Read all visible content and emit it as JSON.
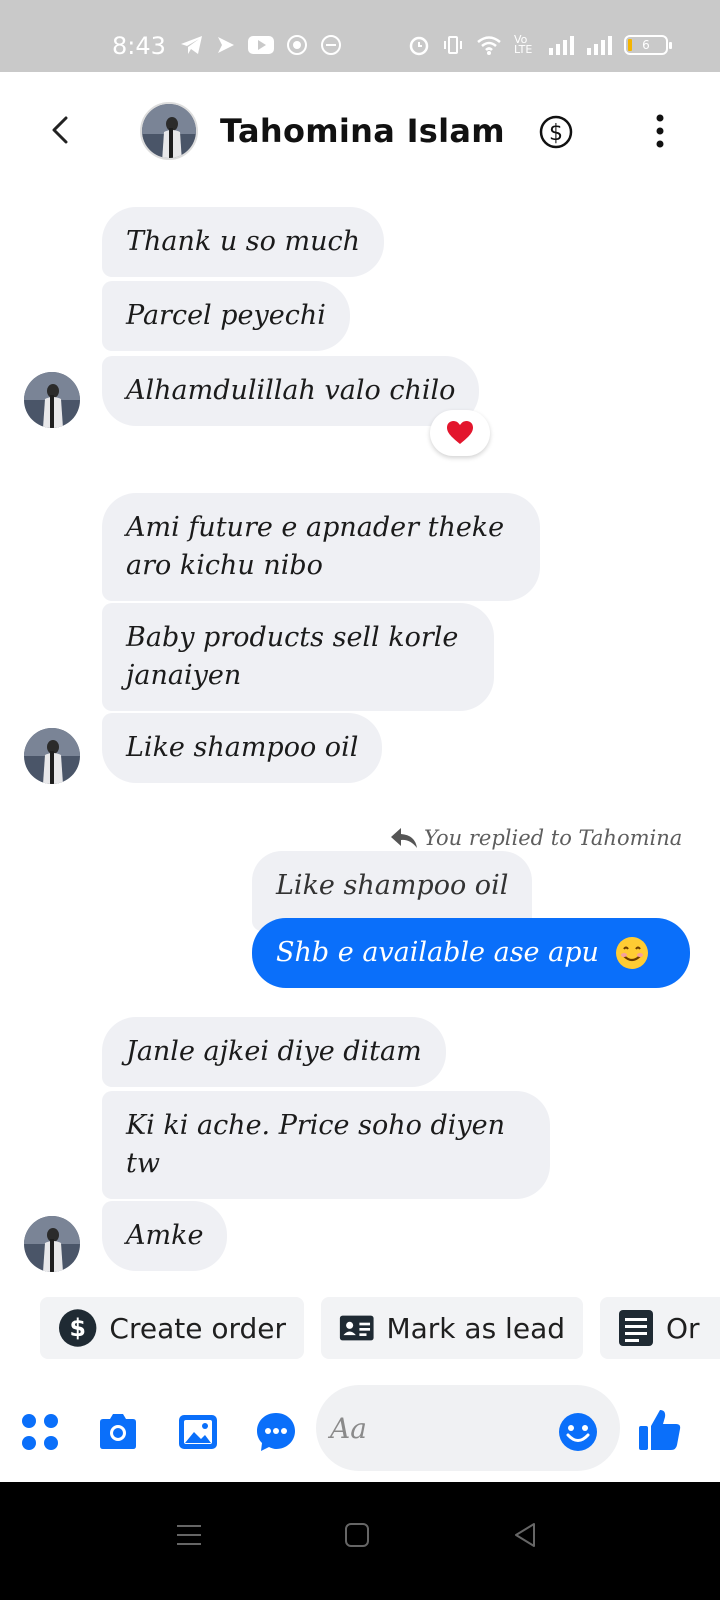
{
  "status_bar": {
    "time": "8:43",
    "battery": "6",
    "icons": [
      "telegram-icon",
      "send-icon",
      "youtube-icon",
      "app-icon",
      "imo-icon",
      "alarm-icon",
      "vibrate-icon",
      "wifi-icon",
      "volte-icon",
      "signal-icon",
      "signal-icon",
      "battery-icon"
    ],
    "volte_label": "Vo LTE"
  },
  "header": {
    "contact_name": "Tahomina Islam",
    "icons": [
      "back-icon",
      "dollar-icon",
      "more-vertical-icon"
    ]
  },
  "messages": [
    {
      "text": "Thank u so much",
      "from": "contact"
    },
    {
      "text": "Parcel peyechi",
      "from": "contact"
    },
    {
      "text": "Alhamdulillah valo chilo",
      "from": "contact",
      "reaction": "heart"
    },
    {
      "text": "Ami future e apnader theke aro kichu nibo",
      "from": "contact"
    },
    {
      "text": "Baby products sell korle janaiyen",
      "from": "contact"
    },
    {
      "text": "Like shampoo oil",
      "from": "contact"
    },
    {
      "reply_note": "You replied to Tahomina",
      "quoted": "Like shampoo oil",
      "text": "Shb e available ase apu",
      "emoji": "smiling-face",
      "from": "me"
    },
    {
      "text": "Janle ajkei diye ditam",
      "from": "contact"
    },
    {
      "text": "Ki ki ache. Price soho diyen tw",
      "from": "contact"
    },
    {
      "text": "Amke",
      "from": "contact"
    }
  ],
  "actions": {
    "create_order": "Create order",
    "mark_as_lead": "Mark as lead",
    "orders_partial": "Or"
  },
  "composer": {
    "placeholder": "Aa",
    "icons": [
      "apps-icon",
      "camera-icon",
      "gallery-icon",
      "chat-more-icon",
      "emoji-icon",
      "like-icon"
    ]
  },
  "colors": {
    "accent": "#0a6ffa",
    "bubble_gray": "#eff0f4",
    "status_bar": "#c9c9c9"
  }
}
